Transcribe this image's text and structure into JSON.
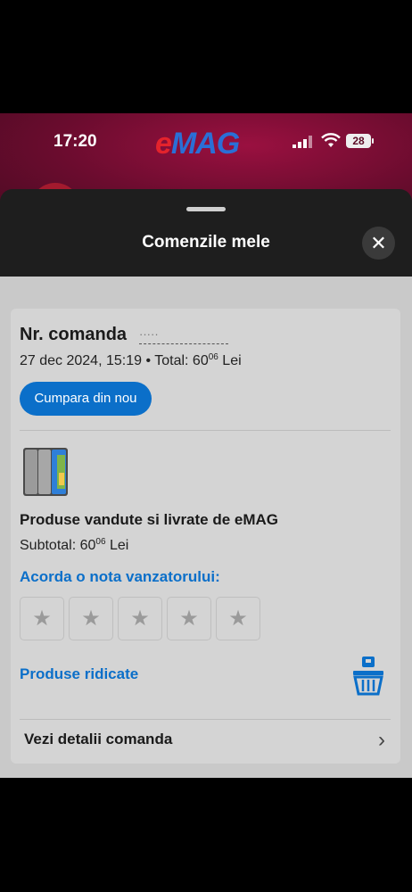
{
  "status_bar": {
    "time": "17:20",
    "battery": "28"
  },
  "app": {
    "logo_e": "e",
    "logo_rest": "MAG"
  },
  "sheet": {
    "title": "Comenzile mele",
    "close_icon": "✕"
  },
  "order": {
    "number_label": "Nr. comanda",
    "number_value": "·····",
    "date": "27 dec 2024, 15:19",
    "separator": "•",
    "total_label": "Total: 60",
    "total_decimals": "06",
    "currency": "Lei",
    "rebuy_button": "Cumpara din nou"
  },
  "seller_block": {
    "seller_text": "Produse vandute si livrate de eMAG",
    "subtotal_label": "Subtotal: 60",
    "subtotal_decimals": "06",
    "currency": "Lei",
    "rate_label": "Acorda o nota vanzatorului:",
    "stars": [
      "★",
      "★",
      "★",
      "★",
      "★"
    ],
    "picked_label": "Produse ridicate",
    "basket_icon": "basket-icon"
  },
  "details": {
    "label": "Vezi detalii comanda",
    "chevron": "›"
  },
  "colors": {
    "accent_blue": "#0b6fc9",
    "sheet_dark": "#1e1e1e",
    "card_grey": "#d4d4d4"
  }
}
